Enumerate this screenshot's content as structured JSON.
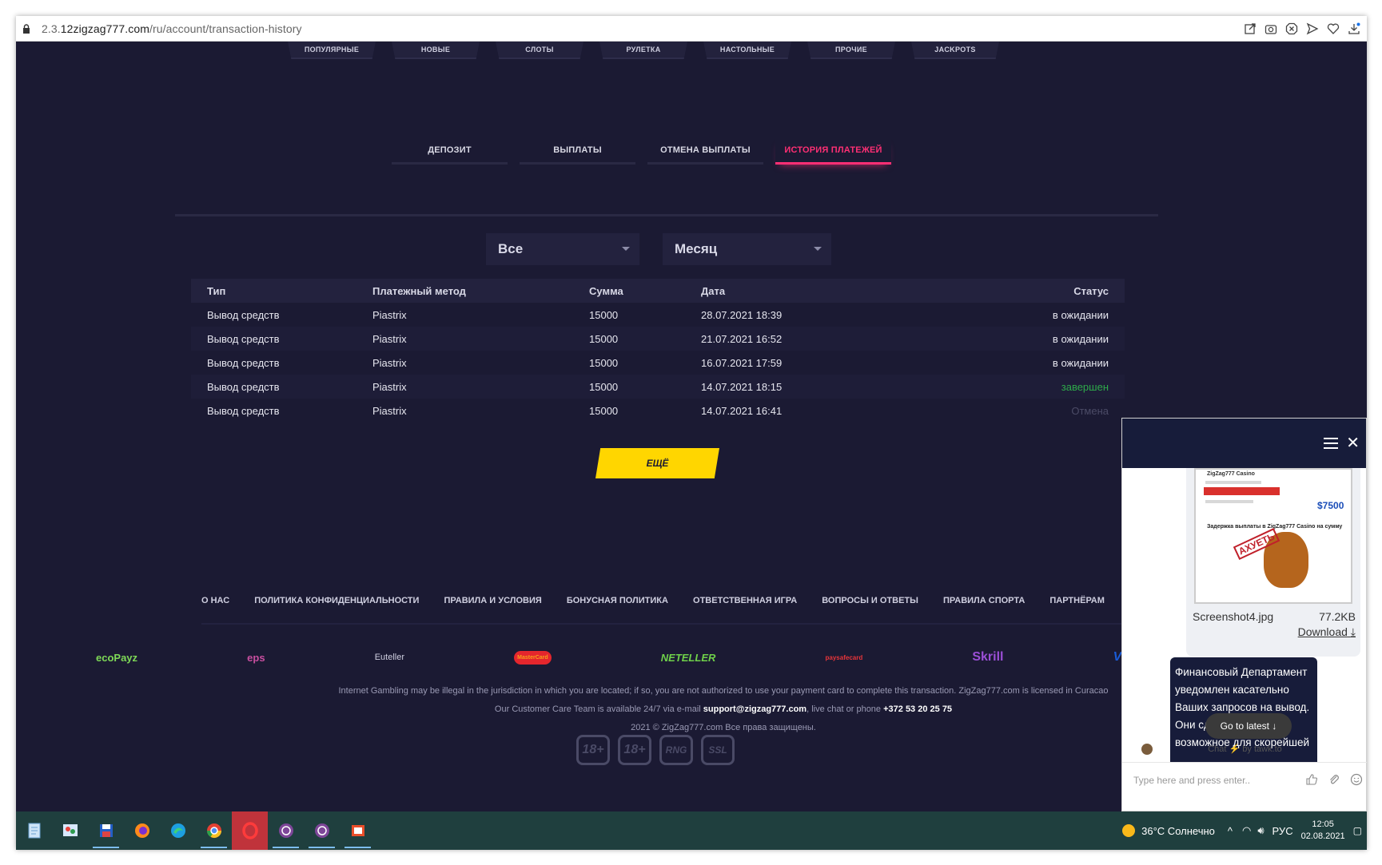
{
  "browser": {
    "url_prefix": "2.3.",
    "url_host": "12zigzag777.com",
    "url_path": "/ru/account/transaction-history"
  },
  "category_nav": [
    "ПОПУЛЯРНЫЕ",
    "НОВЫЕ",
    "СЛОТЫ",
    "РУЛЕТКА",
    "НАСТОЛЬНЫЕ",
    "ПРОЧИЕ",
    "JACKPOTS"
  ],
  "account_tabs": [
    {
      "label": "ДЕПОЗИТ",
      "active": false
    },
    {
      "label": "ВЫПЛАТЫ",
      "active": false
    },
    {
      "label": "ОТМЕНА ВЫПЛАТЫ",
      "active": false
    },
    {
      "label": "ИСТОРИЯ ПЛАТЕЖЕЙ",
      "active": true
    }
  ],
  "filters": {
    "type_value": "Все",
    "period_value": "Месяц"
  },
  "table": {
    "headers": [
      "Тип",
      "Платежный метод",
      "Сумма",
      "Дата",
      "Статус"
    ],
    "rows": [
      {
        "type": "Вывод средств",
        "method": "Piastrix",
        "amount": "15000",
        "date": "28.07.2021 18:39",
        "status": "в ожидании"
      },
      {
        "type": "Вывод средств",
        "method": "Piastrix",
        "amount": "15000",
        "date": "21.07.2021 16:52",
        "status": "в ожидании"
      },
      {
        "type": "Вывод средств",
        "method": "Piastrix",
        "amount": "15000",
        "date": "16.07.2021 17:59",
        "status": "в ожидании"
      },
      {
        "type": "Вывод средств",
        "method": "Piastrix",
        "amount": "15000",
        "date": "14.07.2021 18:15",
        "status": "завершен"
      },
      {
        "type": "Вывод средств",
        "method": "Piastrix",
        "amount": "15000",
        "date": "14.07.2021 16:41",
        "status": "Отмена"
      }
    ]
  },
  "more_button": "ЕЩЁ",
  "footer_links": [
    "О НАС",
    "ПОЛИТИКА КОНФИДЕНЦИАЛЬНОСТИ",
    "ПРАВИЛА И УСЛОВИЯ",
    "БОНУСНАЯ ПОЛИТИКА",
    "ОТВЕТСТВЕННАЯ ИГРА",
    "ВОПРОСЫ И ОТВЕТЫ",
    "ПРАВИЛА СПОРТА",
    "ПАРТНЁРАМ"
  ],
  "payment_logos": [
    {
      "text": "ecoPayz",
      "color": "#7ed957"
    },
    {
      "text": "eps",
      "color": "#c94fa0"
    },
    {
      "text": "Euteller",
      "color": "#cfcfe0"
    },
    {
      "text": "MasterCard",
      "color": "#f79e1b"
    },
    {
      "text": "NETELLER",
      "color": "#6fd14a"
    },
    {
      "text": "paysafecard",
      "color": "#e8353a"
    },
    {
      "text": "Skrill",
      "color": "#9b4fd6"
    },
    {
      "text": "VISA",
      "color": "#1a5bd6"
    }
  ],
  "legal": {
    "line1": "Internet Gambling may be illegal in the jurisdiction in which you are located; if so, you are not authorized to use your payment card to complete this transaction. ZigZag777.com is licensed in Curacao",
    "line2_pre": "Our Customer Care Team is available 24/7 via e-mail ",
    "email": "support@zigzag777.com",
    "line2_mid": ", live chat or phone ",
    "phone": "+372 53 20 25 75",
    "copyright": "2021 © ZigZag777.com Все права защищены."
  },
  "badges": [
    "18+",
    "18+",
    "RNG",
    "SSL"
  ],
  "chat": {
    "thumb_title": "ZigZag777 Casino",
    "thumb_amount": "$7500",
    "thumb_text": "Задержка выплаты в ZigZag777 Casino на сумму",
    "thumb_stamp": "АХУЕТЬ",
    "file_name": "Screenshot4.jpg",
    "file_size": "77.2KB",
    "download_label": "Download",
    "message": "Финансовый Департамент уведомлен касательно Ваших запросов на вывод. Они сделают все возможное для скорейшей",
    "goto_latest": "Go to latest",
    "powered_chat": "Chat",
    "powered_by": "by tawk.to",
    "input_placeholder": "Type here and press enter.."
  },
  "taskbar": {
    "weather": "36°C  Солнечно",
    "lang": "РУС",
    "time": "12:05",
    "date": "02.08.2021"
  },
  "colors": {
    "page_bg": "#1b1a33",
    "accent_pink": "#ff2f74",
    "accent_yellow": "#ffd600",
    "link_blue": "#3e98ff",
    "status_done": "#2eaa4a"
  }
}
